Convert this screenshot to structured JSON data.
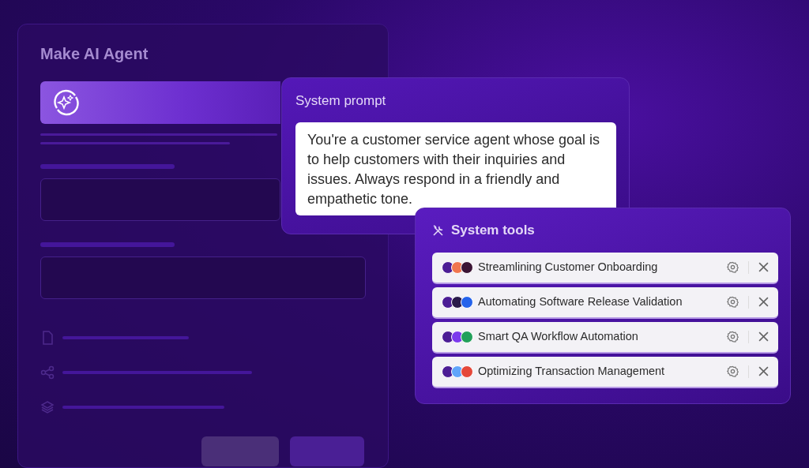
{
  "agent_panel": {
    "title": "Make AI Agent"
  },
  "system_prompt": {
    "title": "System prompt",
    "value": "You're a customer service agent whose goal is to help customers with their inquiries and issues. Always respond in a friendly and empathetic tone."
  },
  "system_tools": {
    "title": "System tools",
    "items": [
      {
        "label": "Streamlining Customer Onboarding",
        "apps": [
          {
            "color": "#4c1d95"
          },
          {
            "color": "#f0764f"
          },
          {
            "color": "#3b1535"
          }
        ]
      },
      {
        "label": "Automating Software Release Validation",
        "apps": [
          {
            "color": "#4c1d95"
          },
          {
            "color": "#2a1a4a"
          },
          {
            "color": "#2563eb"
          }
        ]
      },
      {
        "label": "Smart QA Workflow Automation",
        "apps": [
          {
            "color": "#4c1d95"
          },
          {
            "color": "#7c3aed"
          },
          {
            "color": "#22a05a"
          }
        ]
      },
      {
        "label": "Optimizing Transaction Management",
        "apps": [
          {
            "color": "#4c1d95"
          },
          {
            "color": "#60a5fa"
          },
          {
            "color": "#e5483a"
          }
        ]
      }
    ]
  }
}
